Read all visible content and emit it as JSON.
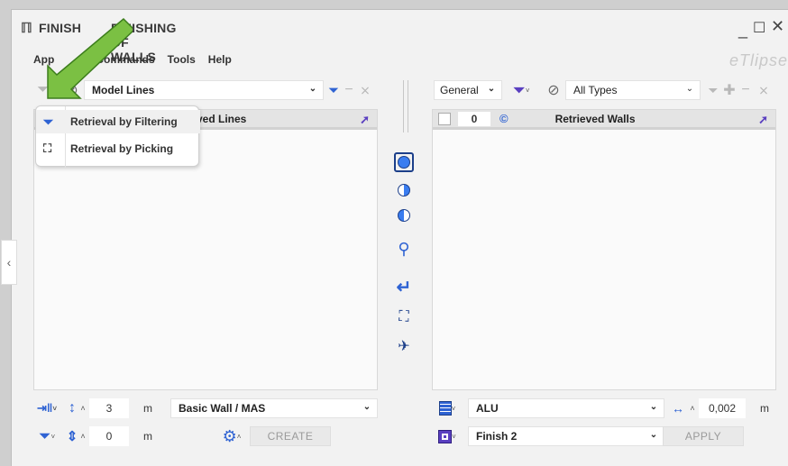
{
  "window": {
    "title": "FINISHING OF WALLS",
    "title_partial": "FINISH",
    "minimize_icon": "minimize-icon",
    "maximize_icon": "maximize-icon",
    "close_icon": "close-icon"
  },
  "menubar": {
    "items": [
      "App",
      "Commands",
      "Tools",
      "Help"
    ]
  },
  "brand": {
    "text": "eTlipse"
  },
  "left": {
    "source_combo": "Model Lines",
    "panel_title": "Retrieved Lines",
    "panel_title_partial": "ved Lines",
    "bottom": {
      "height_value": "3",
      "height_unit": "m",
      "wall_type": "Basic Wall / MAS",
      "offset_value": "0",
      "offset_unit": "m",
      "create_label": "CREATE"
    }
  },
  "popup": {
    "items": [
      {
        "label": "Retrieval by Filtering",
        "icon": "filter-icon"
      },
      {
        "label": "Retrieval by Picking",
        "icon": "pick-icon"
      }
    ]
  },
  "right": {
    "category_combo": "General",
    "types_combo": "All Types",
    "count": "0",
    "panel_title": "Retrieved Walls",
    "bottom": {
      "material": "ALU",
      "thickness_value": "0,002",
      "thickness_unit": "m",
      "finish": "Finish 2",
      "apply_label": "APPLY"
    }
  },
  "colors": {
    "accent_blue": "#2f63d3",
    "accent_purple": "#5a3fc0",
    "arrow_green": "#7bc043",
    "window_bg": "#f2f2f2"
  },
  "icons": {
    "center_toolbar": [
      "full-circle-icon",
      "half-circle-left-icon",
      "half-circle-right-icon",
      "zoom-icon",
      "return-icon",
      "focus-icon",
      "unselect-icon"
    ]
  }
}
